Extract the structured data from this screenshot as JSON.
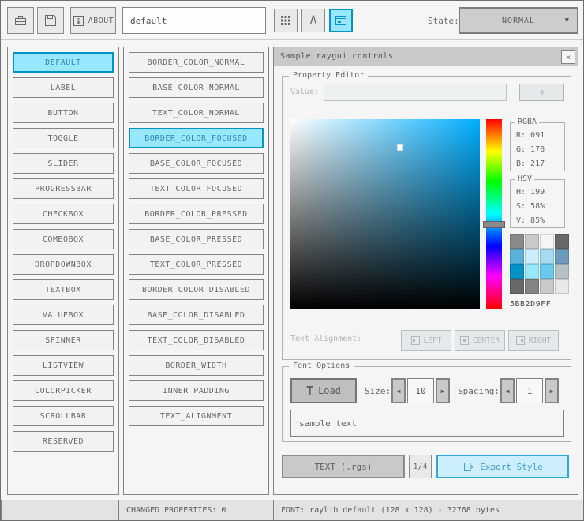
{
  "colors": {
    "background": "#f5f5f5",
    "border": "#838383",
    "text": "#686868",
    "selected_border": "#0492c7",
    "selected_bg": "#97e8ff",
    "selected_text": "#2e8bb0",
    "focused_border": "#5bb2d9",
    "focused_bg": "#c9effe",
    "disabled_text": "#aeb7b8",
    "picker_selected_color": "#5bb2d9",
    "picker_hue_color": "#00aeff"
  },
  "toolbar": {
    "about_button": "ABOUT",
    "style_name_input": "default",
    "state_label": "State:",
    "state_dropdown": "NORMAL"
  },
  "icons": {
    "close": "×",
    "dropdown_arrow": "▼",
    "arrow_left": "◀",
    "arrow_right": "▶",
    "load_glyph": "T",
    "font_glyph": "A"
  },
  "controls_panel": {
    "items": [
      "DEFAULT",
      "LABEL",
      "BUTTON",
      "TOGGLE",
      "SLIDER",
      "PROGRESSBAR",
      "CHECKBOX",
      "COMBOBOX",
      "DROPDOWNBOX",
      "TEXTBOX",
      "VALUEBOX",
      "SPINNER",
      "LISTVIEW",
      "COLORPICKER",
      "SCROLLBAR",
      "RESERVED"
    ],
    "selected": "DEFAULT"
  },
  "properties_panel": {
    "items": [
      "BORDER_COLOR_NORMAL",
      "BASE_COLOR_NORMAL",
      "TEXT_COLOR_NORMAL",
      "BORDER_COLOR_FOCUSED",
      "BASE_COLOR_FOCUSED",
      "TEXT_COLOR_FOCUSED",
      "BORDER_COLOR_PRESSED",
      "BASE_COLOR_PRESSED",
      "TEXT_COLOR_PRESSED",
      "BORDER_COLOR_DISABLED",
      "BASE_COLOR_DISABLED",
      "TEXT_COLOR_DISABLED",
      "BORDER_WIDTH",
      "INNER_PADDING",
      "TEXT_ALIGNMENT"
    ],
    "selected": "BORDER_COLOR_FOCUSED"
  },
  "sample_window": {
    "title": "Sample raygui controls",
    "property_editor": {
      "label": "Property Editor",
      "value_label": "Value:",
      "value_input": "",
      "value_button": "0",
      "rgba_label": "RGBA",
      "rgba": {
        "r": "R: 091",
        "g": "G: 178",
        "b": "B: 217"
      },
      "hsv_label": "HSV",
      "hsv": {
        "h": "H: 199",
        "s": "S: 58%",
        "v": "V: 85%"
      },
      "hex_value": "5BB2D9FF",
      "swatches": [
        "#898989",
        "#c9c9c9",
        "#f5f5f5",
        "#686868",
        "#5bb2d9",
        "#c9effe",
        "#a5dbf0",
        "#6c9bbc",
        "#0492c7",
        "#97e8ff",
        "#68c9ee",
        "#b5c1c2",
        "#686868",
        "#838383",
        "#c9c9c9",
        "#e6e9e9"
      ],
      "alignment_label": "Text Alignment:",
      "alignment_buttons": [
        "LEFT",
        "CENTER",
        "RIGHT"
      ]
    },
    "font_options": {
      "label": "Font Options",
      "load_button": "Load",
      "size_label": "Size:",
      "size_value": "10",
      "spacing_label": "Spacing:",
      "spacing_value": "1",
      "sample_text": "sample text"
    },
    "footer": {
      "text_rgs_button": "TEXT (.rgs)",
      "counter": "1/4",
      "export_button": "Export Style"
    }
  },
  "statusbar": {
    "changed_properties": "CHANGED PROPERTIES: 0",
    "font_info": "FONT: raylib default (128 x 128) - 32768 bytes"
  }
}
